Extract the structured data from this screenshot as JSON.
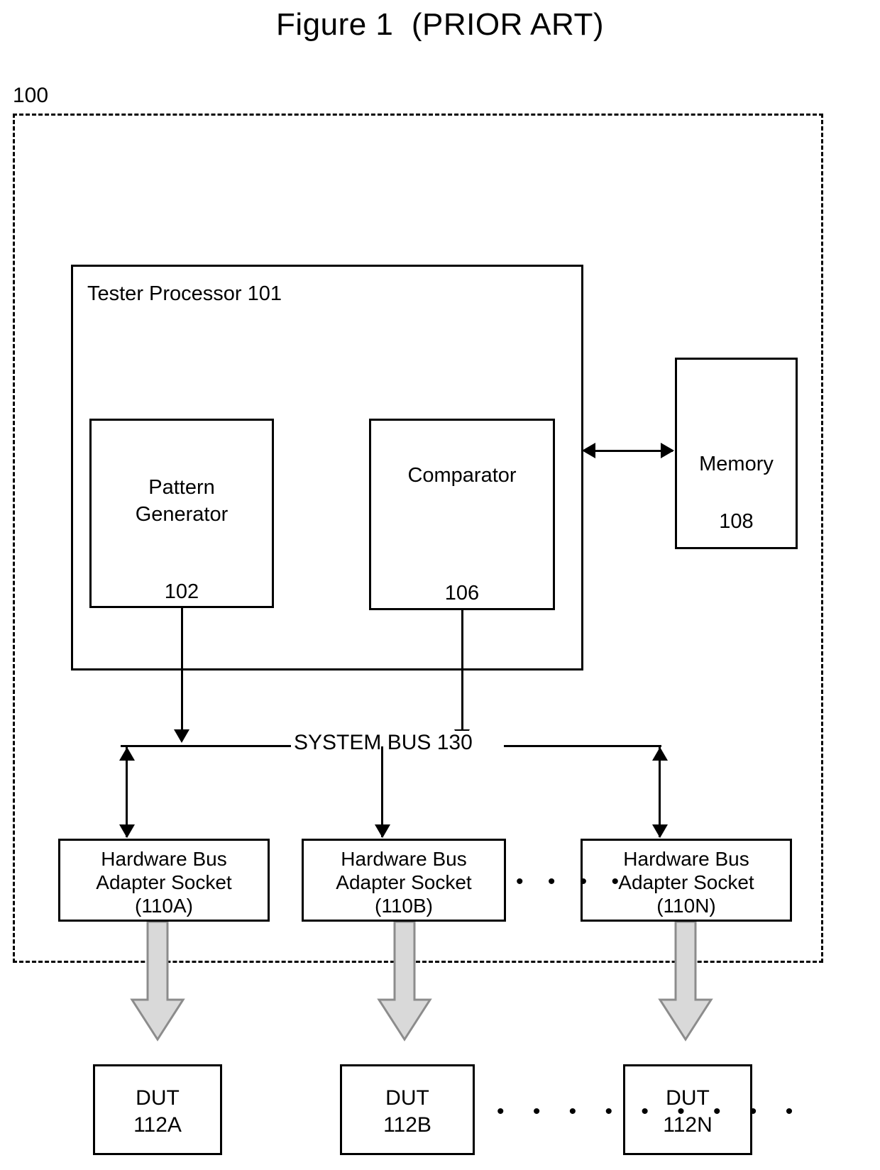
{
  "figure": {
    "title": "Figure 1  (PRIOR ART)",
    "system_reference": "100"
  },
  "tester_processor": {
    "label": "Tester Processor 101",
    "pattern_generator": {
      "name": "Pattern\nGenerator",
      "ref": "102"
    },
    "comparator": {
      "name": "Comparator",
      "ref": "106"
    }
  },
  "memory": {
    "name": "Memory",
    "ref": "108"
  },
  "bus": {
    "label": "SYSTEM BUS 130"
  },
  "sockets": [
    {
      "name": "Hardware Bus\nAdapter Socket",
      "ref": "(110A)"
    },
    {
      "name": "Hardware Bus\nAdapter Socket",
      "ref": "(110B)"
    },
    {
      "name": "Hardware Bus\nAdapter Socket",
      "ref": "(110N)"
    }
  ],
  "socket_ellipsis": "• • • •",
  "duts": [
    {
      "name": "DUT",
      "ref": "112A"
    },
    {
      "name": "DUT",
      "ref": "112B"
    },
    {
      "name": "DUT",
      "ref": "112N"
    }
  ],
  "dut_ellipsis": "• • • • • • • • •",
  "colors": {
    "stroke": "#000000",
    "background": "#ffffff",
    "block_arrow_fill": "#d9d9d9",
    "block_arrow_stroke": "#8c8c8c"
  }
}
